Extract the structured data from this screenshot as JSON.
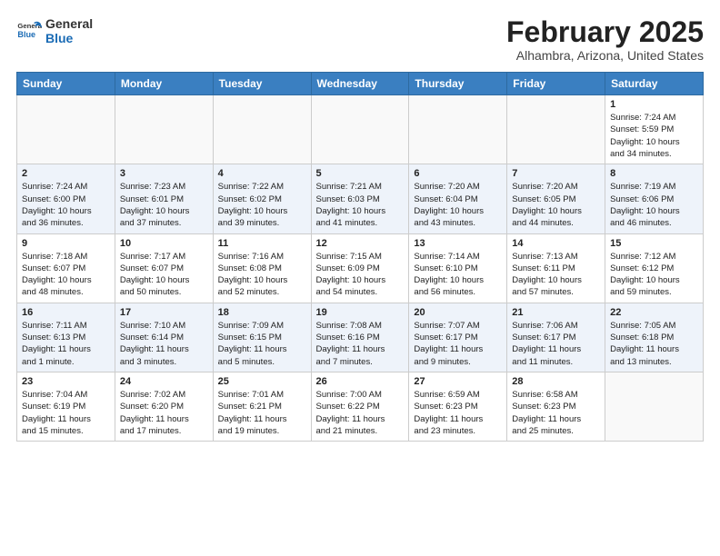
{
  "header": {
    "logo_line1": "General",
    "logo_line2": "Blue",
    "month": "February 2025",
    "location": "Alhambra, Arizona, United States"
  },
  "weekdays": [
    "Sunday",
    "Monday",
    "Tuesday",
    "Wednesday",
    "Thursday",
    "Friday",
    "Saturday"
  ],
  "weeks": [
    [
      {
        "day": "",
        "info": ""
      },
      {
        "day": "",
        "info": ""
      },
      {
        "day": "",
        "info": ""
      },
      {
        "day": "",
        "info": ""
      },
      {
        "day": "",
        "info": ""
      },
      {
        "day": "",
        "info": ""
      },
      {
        "day": "1",
        "info": "Sunrise: 7:24 AM\nSunset: 5:59 PM\nDaylight: 10 hours\nand 34 minutes."
      }
    ],
    [
      {
        "day": "2",
        "info": "Sunrise: 7:24 AM\nSunset: 6:00 PM\nDaylight: 10 hours\nand 36 minutes."
      },
      {
        "day": "3",
        "info": "Sunrise: 7:23 AM\nSunset: 6:01 PM\nDaylight: 10 hours\nand 37 minutes."
      },
      {
        "day": "4",
        "info": "Sunrise: 7:22 AM\nSunset: 6:02 PM\nDaylight: 10 hours\nand 39 minutes."
      },
      {
        "day": "5",
        "info": "Sunrise: 7:21 AM\nSunset: 6:03 PM\nDaylight: 10 hours\nand 41 minutes."
      },
      {
        "day": "6",
        "info": "Sunrise: 7:20 AM\nSunset: 6:04 PM\nDaylight: 10 hours\nand 43 minutes."
      },
      {
        "day": "7",
        "info": "Sunrise: 7:20 AM\nSunset: 6:05 PM\nDaylight: 10 hours\nand 44 minutes."
      },
      {
        "day": "8",
        "info": "Sunrise: 7:19 AM\nSunset: 6:06 PM\nDaylight: 10 hours\nand 46 minutes."
      }
    ],
    [
      {
        "day": "9",
        "info": "Sunrise: 7:18 AM\nSunset: 6:07 PM\nDaylight: 10 hours\nand 48 minutes."
      },
      {
        "day": "10",
        "info": "Sunrise: 7:17 AM\nSunset: 6:07 PM\nDaylight: 10 hours\nand 50 minutes."
      },
      {
        "day": "11",
        "info": "Sunrise: 7:16 AM\nSunset: 6:08 PM\nDaylight: 10 hours\nand 52 minutes."
      },
      {
        "day": "12",
        "info": "Sunrise: 7:15 AM\nSunset: 6:09 PM\nDaylight: 10 hours\nand 54 minutes."
      },
      {
        "day": "13",
        "info": "Sunrise: 7:14 AM\nSunset: 6:10 PM\nDaylight: 10 hours\nand 56 minutes."
      },
      {
        "day": "14",
        "info": "Sunrise: 7:13 AM\nSunset: 6:11 PM\nDaylight: 10 hours\nand 57 minutes."
      },
      {
        "day": "15",
        "info": "Sunrise: 7:12 AM\nSunset: 6:12 PM\nDaylight: 10 hours\nand 59 minutes."
      }
    ],
    [
      {
        "day": "16",
        "info": "Sunrise: 7:11 AM\nSunset: 6:13 PM\nDaylight: 11 hours\nand 1 minute."
      },
      {
        "day": "17",
        "info": "Sunrise: 7:10 AM\nSunset: 6:14 PM\nDaylight: 11 hours\nand 3 minutes."
      },
      {
        "day": "18",
        "info": "Sunrise: 7:09 AM\nSunset: 6:15 PM\nDaylight: 11 hours\nand 5 minutes."
      },
      {
        "day": "19",
        "info": "Sunrise: 7:08 AM\nSunset: 6:16 PM\nDaylight: 11 hours\nand 7 minutes."
      },
      {
        "day": "20",
        "info": "Sunrise: 7:07 AM\nSunset: 6:17 PM\nDaylight: 11 hours\nand 9 minutes."
      },
      {
        "day": "21",
        "info": "Sunrise: 7:06 AM\nSunset: 6:17 PM\nDaylight: 11 hours\nand 11 minutes."
      },
      {
        "day": "22",
        "info": "Sunrise: 7:05 AM\nSunset: 6:18 PM\nDaylight: 11 hours\nand 13 minutes."
      }
    ],
    [
      {
        "day": "23",
        "info": "Sunrise: 7:04 AM\nSunset: 6:19 PM\nDaylight: 11 hours\nand 15 minutes."
      },
      {
        "day": "24",
        "info": "Sunrise: 7:02 AM\nSunset: 6:20 PM\nDaylight: 11 hours\nand 17 minutes."
      },
      {
        "day": "25",
        "info": "Sunrise: 7:01 AM\nSunset: 6:21 PM\nDaylight: 11 hours\nand 19 minutes."
      },
      {
        "day": "26",
        "info": "Sunrise: 7:00 AM\nSunset: 6:22 PM\nDaylight: 11 hours\nand 21 minutes."
      },
      {
        "day": "27",
        "info": "Sunrise: 6:59 AM\nSunset: 6:23 PM\nDaylight: 11 hours\nand 23 minutes."
      },
      {
        "day": "28",
        "info": "Sunrise: 6:58 AM\nSunset: 6:23 PM\nDaylight: 11 hours\nand 25 minutes."
      },
      {
        "day": "",
        "info": ""
      }
    ]
  ]
}
